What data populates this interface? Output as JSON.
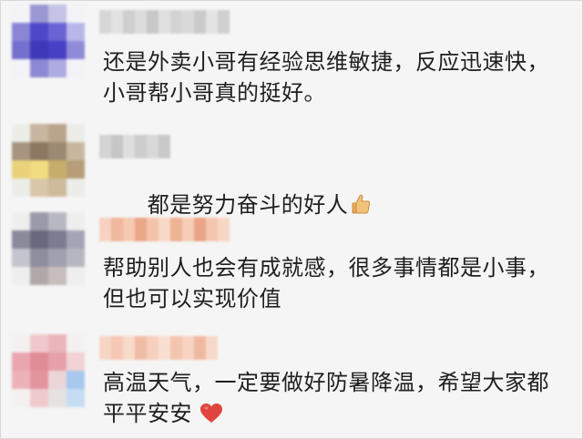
{
  "comments": [
    {
      "text": "还是外卖小哥有经验思维敏捷，反应迅速快，\n小哥帮小哥真的挺好。",
      "emoji": ""
    },
    {
      "text": "都是努力奋斗的好人",
      "emoji": "thumbs-up-icon"
    },
    {
      "text": "帮助别人也会有成就感，很多事情都是小事，\n但也可以实现价值",
      "emoji": ""
    },
    {
      "text": "高温天气，一定要做好防暑降温，希望大家都\n平平安安",
      "emoji": "heart-icon"
    }
  ],
  "colors": {
    "background": "#f5f5f5",
    "text": "#1f1f1f",
    "heart": "#e0443e",
    "thumb": "#f2c27a"
  }
}
